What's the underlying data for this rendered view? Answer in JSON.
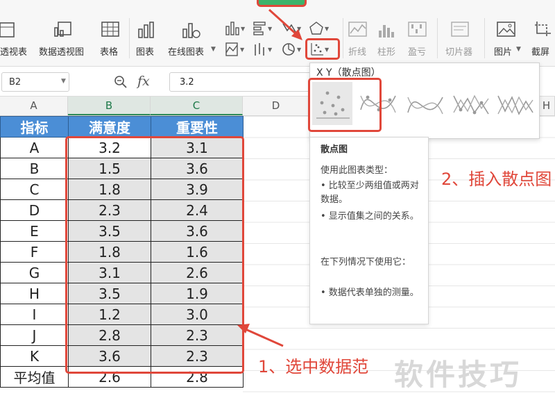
{
  "ribbon": {
    "items": [
      {
        "label": "透视表",
        "icon": "pivot-table-icon"
      },
      {
        "label": "数据透视图",
        "icon": "pivot-chart-icon"
      },
      {
        "label": "表格",
        "icon": "table-icon"
      },
      {
        "label": "图表",
        "icon": "chart-icon"
      },
      {
        "label": "在线图表",
        "icon": "online-chart-icon"
      },
      {
        "label": "折线",
        "icon": "line-sparkline-icon"
      },
      {
        "label": "柱形",
        "icon": "column-sparkline-icon"
      },
      {
        "label": "盈亏",
        "icon": "winloss-sparkline-icon"
      },
      {
        "label": "切片器",
        "icon": "slicer-icon"
      },
      {
        "label": "图片",
        "icon": "picture-icon"
      },
      {
        "label": "截屏",
        "icon": "screenshot-icon"
      }
    ]
  },
  "formula_bar": {
    "name_box": "B2",
    "fx": "fx",
    "value": "3.2"
  },
  "columns": [
    "A",
    "B",
    "C",
    "D",
    "H"
  ],
  "table": {
    "headers": [
      "指标",
      "满意度",
      "重要性"
    ],
    "rows": [
      [
        "A",
        "3.2",
        "3.1"
      ],
      [
        "B",
        "1.5",
        "3.6"
      ],
      [
        "C",
        "1.8",
        "3.9"
      ],
      [
        "D",
        "2.3",
        "2.4"
      ],
      [
        "E",
        "3.5",
        "3.6"
      ],
      [
        "F",
        "1.8",
        "1.6"
      ],
      [
        "G",
        "3.1",
        "2.6"
      ],
      [
        "H",
        "3.5",
        "1.9"
      ],
      [
        "I",
        "1.2",
        "3.0"
      ],
      [
        "J",
        "2.8",
        "2.3"
      ],
      [
        "K",
        "3.6",
        "2.3"
      ],
      [
        "平均值",
        "2.6",
        "2.8"
      ]
    ]
  },
  "dropdown": {
    "title": "X Y（散点图）"
  },
  "tooltip": {
    "title": "散点图",
    "lines": [
      "使用此图表类型：",
      "• 比较至少两组值或两对数据。",
      "• 显示值集之间的关系。",
      "",
      "在下列情况下使用它：",
      "• 数据代表单独的测量。"
    ]
  },
  "annotations": {
    "step1": "1、选中数据范",
    "step2": "2、插入散点图"
  },
  "watermark": "软件技巧",
  "colors": {
    "accent_red": "#e0473a",
    "header_blue": "#4b8ed6",
    "select_green": "#2e8b57"
  }
}
